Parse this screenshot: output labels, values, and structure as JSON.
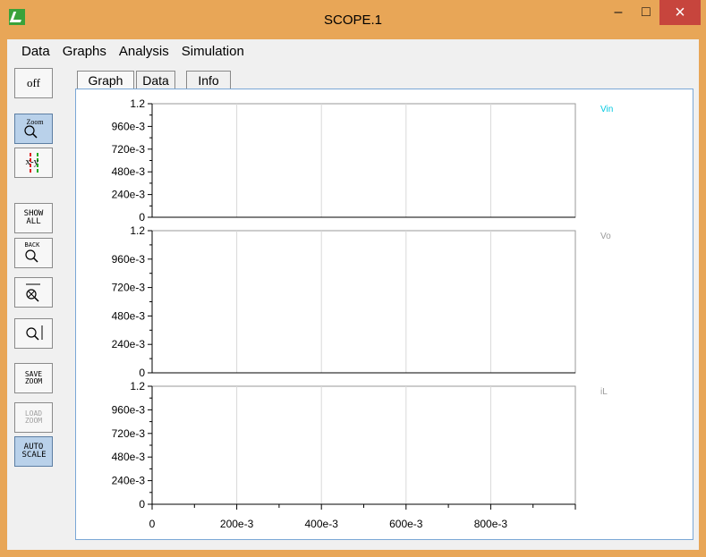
{
  "window": {
    "title": "SCOPE.1",
    "min_glyph": "–",
    "max_glyph": "□",
    "close_glyph": "×"
  },
  "menu": [
    "Data",
    "Graphs",
    "Analysis",
    "Simulation"
  ],
  "toolbar": {
    "off": "off",
    "zoom": "Zoom",
    "xy": "x-y",
    "show_all": "SHOW ALL",
    "back": "BACK",
    "save_zoom": "SAVE ZOOM",
    "load_zoom": "LOAD ZOOM",
    "auto_scale": "AUTO SCALE"
  },
  "tabs": [
    "Graph",
    "Data",
    "Info"
  ],
  "chart_data": [
    {
      "type": "line",
      "series": [
        {
          "name": "Vin",
          "values": []
        }
      ],
      "ylim": [
        0,
        1.2
      ],
      "yticks": [
        "0",
        "240e-3",
        "480e-3",
        "720e-3",
        "960e-3",
        "1.2"
      ],
      "xlim": [
        0,
        1
      ],
      "color": "#00c8e0"
    },
    {
      "type": "line",
      "series": [
        {
          "name": "Vo",
          "values": []
        }
      ],
      "ylim": [
        0,
        1.2
      ],
      "yticks": [
        "0",
        "240e-3",
        "480e-3",
        "720e-3",
        "960e-3",
        "1.2"
      ],
      "xlim": [
        0,
        1
      ],
      "color": "#9a9a9a"
    },
    {
      "type": "line",
      "series": [
        {
          "name": "iL",
          "values": []
        }
      ],
      "ylim": [
        0,
        1.2
      ],
      "yticks": [
        "0",
        "240e-3",
        "480e-3",
        "720e-3",
        "960e-3",
        "1.2"
      ],
      "xlim": [
        0,
        1
      ],
      "xticks": [
        "0",
        "200e-3",
        "400e-3",
        "600e-3",
        "800e-3"
      ],
      "color": "#9a9a9a"
    }
  ]
}
